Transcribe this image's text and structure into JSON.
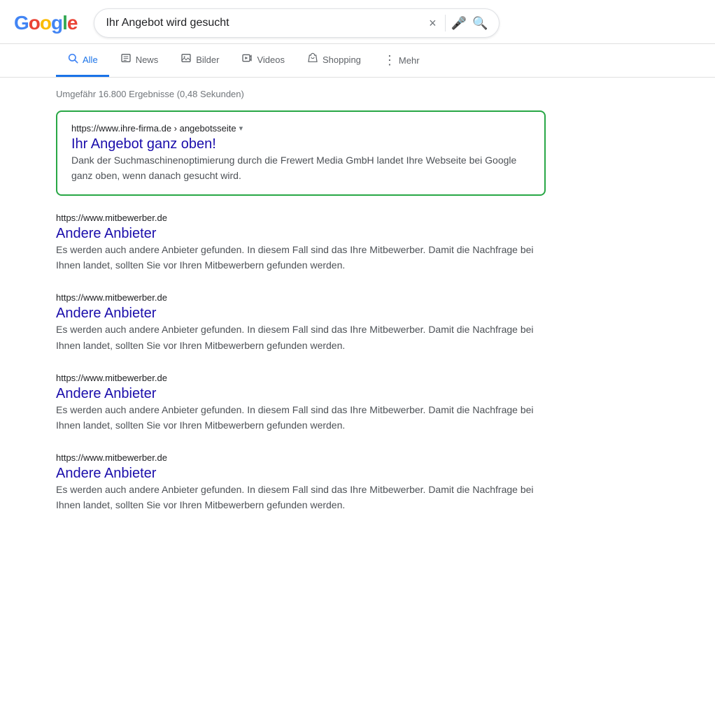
{
  "header": {
    "logo_letters": [
      {
        "letter": "G",
        "color_class": "g-blue"
      },
      {
        "letter": "o",
        "color_class": "g-red"
      },
      {
        "letter": "o",
        "color_class": "g-yellow"
      },
      {
        "letter": "g",
        "color_class": "g-blue"
      },
      {
        "letter": "l",
        "color_class": "g-green"
      },
      {
        "letter": "e",
        "color_class": "g-red"
      }
    ],
    "search_query": "Ihr Angebot wird gesucht",
    "clear_icon": "×",
    "voice_icon": "🎤",
    "search_icon": "🔍"
  },
  "nav": {
    "tabs": [
      {
        "id": "alle",
        "label": "Alle",
        "icon": "🔍",
        "active": true
      },
      {
        "id": "news",
        "label": "News",
        "icon": "🗞",
        "active": false
      },
      {
        "id": "bilder",
        "label": "Bilder",
        "icon": "🖼",
        "active": false
      },
      {
        "id": "videos",
        "label": "Videos",
        "icon": "▶",
        "active": false
      },
      {
        "id": "shopping",
        "label": "Shopping",
        "icon": "🏷",
        "active": false
      }
    ],
    "more_label": "Mehr",
    "more_icon": "⋮"
  },
  "results": {
    "count_text": "Umgefähr 16.800 Ergebnisse (0,48 Sekunden)",
    "featured": {
      "url": "https://www.ihre-firma.de › angebotsseite",
      "url_arrow": "▾",
      "title": "Ihr Angebot ganz oben!",
      "description": "Dank der Suchmaschinenoptimierung durch die Frewert Media GmbH landet Ihre Webseite bei Google ganz oben, wenn danach gesucht wird."
    },
    "items": [
      {
        "url": "https://www.mitbewerber.de",
        "title": "Andere Anbieter",
        "description": "Es werden auch andere Anbieter gefunden. In diesem Fall sind das Ihre Mitbewerber. Damit die Nachfrage bei Ihnen landet, sollten Sie vor Ihren Mitbewerbern gefunden werden."
      },
      {
        "url": "https://www.mitbewerber.de",
        "title": "Andere Anbieter",
        "description": "Es werden auch andere Anbieter gefunden. In diesem Fall sind das Ihre Mitbewerber. Damit die Nachfrage bei Ihnen landet, sollten Sie vor Ihren Mitbewerbern gefunden werden."
      },
      {
        "url": "https://www.mitbewerber.de",
        "title": "Andere Anbieter",
        "description": "Es werden auch andere Anbieter gefunden. In diesem Fall sind das Ihre Mitbewerber. Damit die Nachfrage bei Ihnen landet, sollten Sie vor Ihren Mitbewerbern gefunden werden."
      },
      {
        "url": "https://www.mitbewerber.de",
        "title": "Andere Anbieter",
        "description": "Es werden auch andere Anbieter gefunden. In diesem Fall sind das Ihre Mitbewerber. Damit die Nachfrage bei Ihnen landet, sollten Sie vor Ihren Mitbewerbern gefunden werden."
      }
    ]
  }
}
